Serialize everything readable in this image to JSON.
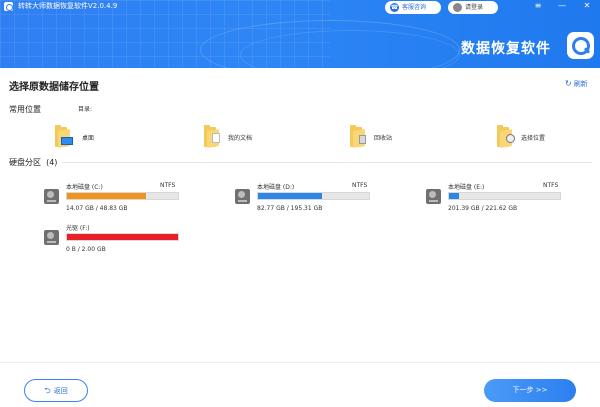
{
  "header": {
    "app_title": "转转大师数据恢复软件V2.0.4.9",
    "consult_label": "客服咨询",
    "login_label": "请登录",
    "menu_glyph": "≡",
    "minimize_glyph": "—",
    "close_glyph": "✕",
    "brand_text": "数据恢复软件"
  },
  "main": {
    "title": "选择原数据储存位置",
    "refresh_label": "刷新",
    "refresh_glyph": "↻",
    "common_label": "常用位置",
    "dir_label": "目录:",
    "locations": [
      {
        "label": "桌面",
        "icon": "desktop-folder-icon"
      },
      {
        "label": "我的文档",
        "icon": "documents-folder-icon"
      },
      {
        "label": "回收站",
        "icon": "recycle-bin-folder-icon"
      },
      {
        "label": "选择位置",
        "icon": "choose-location-folder-icon"
      }
    ],
    "disk_label": "硬盘分区",
    "disk_count": "(4)",
    "drives": [
      {
        "name": "本地磁盘   (C:)",
        "fs": "NTFS",
        "size": "14.07 GB / 48.83 GB",
        "used_fraction": 0.71,
        "color": "#f0941f"
      },
      {
        "name": "本地磁盘   (D:)",
        "fs": "NTFS",
        "size": "82.77 GB / 195.31 GB",
        "used_fraction": 0.58,
        "color": "#2b86e8"
      },
      {
        "name": "本地磁盘   (E:)",
        "fs": "NTFS",
        "size": "201.39 GB / 221.62 GB",
        "used_fraction": 0.09,
        "color": "#2b86e8"
      },
      {
        "name": "光驱   (F:)",
        "fs": "",
        "size": "0 B / 2.00 GB",
        "used_fraction": 1.0,
        "color": "#e8202a"
      }
    ]
  },
  "footer": {
    "back_label": "返回",
    "back_glyph": "⮌",
    "next_label": "下一步 >>"
  }
}
